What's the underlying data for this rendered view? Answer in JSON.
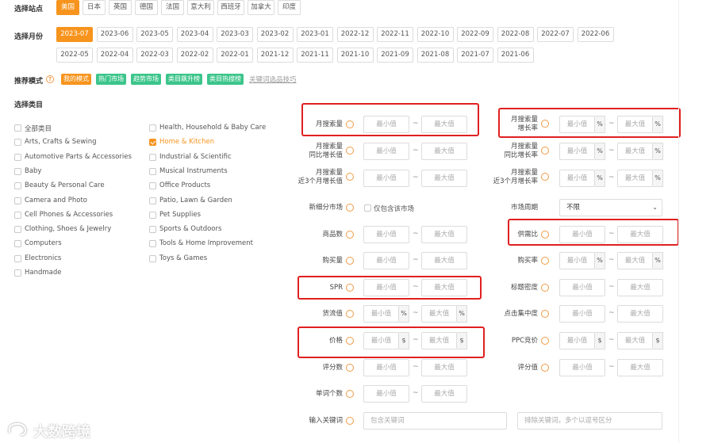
{
  "site": {
    "label": "选择站点",
    "options": [
      "美国",
      "日本",
      "英国",
      "德国",
      "法国",
      "意大利",
      "西班牙",
      "加拿大",
      "印度"
    ],
    "selected": "美国"
  },
  "month": {
    "label": "选择月份",
    "row1": [
      "2023-07",
      "2023-06",
      "2023-05",
      "2023-04",
      "2023-03",
      "2023-02",
      "2023-01",
      "2022-12",
      "2022-11",
      "2022-10",
      "2022-09",
      "2022-08",
      "2022-07",
      "2022-06"
    ],
    "row2": [
      "2022-05",
      "2022-04",
      "2022-03",
      "2022-02",
      "2022-01",
      "2021-12",
      "2021-11",
      "2021-10",
      "2021-09",
      "2021-08",
      "2021-07",
      "2021-06"
    ],
    "selected": "2023-07"
  },
  "mode": {
    "label": "推荐模式",
    "tags": [
      {
        "text": "我的模式",
        "color": "#f7941d"
      },
      {
        "text": "热门市场",
        "color": "#3cc58b"
      },
      {
        "text": "趋势市场",
        "color": "#3cc58b"
      },
      {
        "text": "类目飙升榜",
        "color": "#3cc58b"
      },
      {
        "text": "类目热搜榜",
        "color": "#3cc58b"
      }
    ],
    "tips_link": "关键词选品技巧"
  },
  "category": {
    "label": "选择类目",
    "col1": [
      "全部类目",
      "Arts, Crafts & Sewing",
      "Automotive Parts & Accessories",
      "Baby",
      "Beauty & Personal Care",
      "Camera and Photo",
      "Cell Phones & Accessories",
      "Clothing, Shoes & Jewelry",
      "Computers",
      "Electronics",
      "Handmade"
    ],
    "col2": [
      "Health, Household & Baby Care",
      "Home & Kitchen",
      "Industrial & Scientific",
      "Musical Instruments",
      "Office Products",
      "Patio, Lawn & Garden",
      "Pet Supplies",
      "Sports & Outdoors",
      "Tools & Home Improvement",
      "Toys & Games"
    ],
    "checked": "Home & Kitchen"
  },
  "placeholders": {
    "min": "最小值",
    "max": "最大值",
    "include_kw": "包含关键词",
    "exclude_kw": "排除关键词，多个以逗号区分"
  },
  "units": {
    "percent": "%",
    "dollar": "$"
  },
  "filters_left": {
    "monthly_search": "月搜索量",
    "yoy_l1": "月搜索量",
    "yoy_l2": "同比增长值",
    "m3_l1": "月搜索量",
    "m3_l2": "近3个月增长值",
    "niche_market": "新细分市场",
    "niche_checkbox": "仅包含该市场",
    "products": "商品数",
    "buy_qty": "购买量",
    "spr": "SPR",
    "supply_value": "货流值",
    "price": "价格",
    "reviews": "评分数",
    "unit_count": "单词个数",
    "keyword_input": "输入关键词"
  },
  "filters_right": {
    "growth_l1": "月搜索量",
    "growth_l2": "增长率",
    "yoy_l1": "月搜索量",
    "yoy_l2": "同比增长率",
    "m3_l1": "月搜索量",
    "m3_l2": "近3个月增长率",
    "market_cycle": "市场周期",
    "market_cycle_value": "不限",
    "supply_demand": "供需比",
    "buy_rate": "购买率",
    "title_density": "标题密度",
    "click_concentration": "点击集中度",
    "ppc_bid": "PPC竞价",
    "rating": "评分值"
  },
  "watermark": "大数跨境",
  "colors": {
    "accent": "#f7941d",
    "green": "#3cc58b",
    "highlight": "#e02020"
  }
}
